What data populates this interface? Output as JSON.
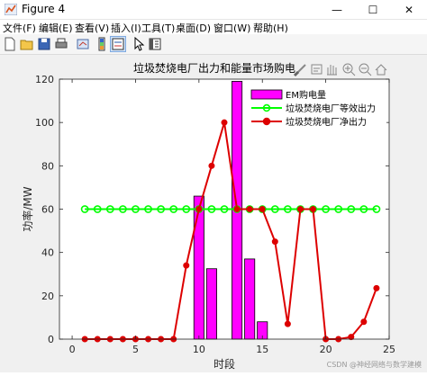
{
  "window": {
    "title": "Figure 4",
    "minimize_glyph": "—",
    "maximize_glyph": "☐",
    "close_glyph": "✕"
  },
  "menu": [
    "文件(F)",
    "编辑(E)",
    "查看(V)",
    "插入(I)",
    "工具(T)",
    "桌面(D)",
    "窗口(W)",
    "帮助(H)"
  ],
  "toolbar_icons": [
    "new-figure-icon",
    "open-file-icon",
    "save-icon",
    "print-icon",
    "link-axes-icon",
    "insert-colorbar-icon",
    "insert-legend-icon",
    "edit-plot-arrow-icon",
    "property-inspector-icon"
  ],
  "axes_toolbar_icons": [
    "brush-icon",
    "data-tips-icon",
    "pan-hand-icon",
    "zoom-in-icon",
    "zoom-out-icon",
    "home-icon"
  ],
  "watermark": "CSDN @神经网络与数学建模",
  "chart_data": {
    "type": "bar+line",
    "title": "垃圾焚烧电厂出力和能量市场购电",
    "xlabel": "时段",
    "ylabel": "功率/MW",
    "xlim": [
      -1,
      25
    ],
    "ylim": [
      0,
      120
    ],
    "xticks": [
      0,
      5,
      10,
      15,
      20,
      25
    ],
    "yticks": [
      0,
      20,
      40,
      60,
      80,
      100,
      120
    ],
    "grid": false,
    "legend_position": "top-right",
    "categories": [
      1,
      2,
      3,
      4,
      5,
      6,
      7,
      8,
      9,
      10,
      11,
      12,
      13,
      14,
      15,
      16,
      17,
      18,
      19,
      20,
      21,
      22,
      23,
      24
    ],
    "series": [
      {
        "name": "EM购电量",
        "type": "bar",
        "color": "#ff00ff",
        "edge": "#000000",
        "values": [
          0,
          0,
          0,
          0,
          0,
          0,
          0,
          0,
          0,
          66,
          32.5,
          0,
          119,
          37,
          8,
          0,
          0,
          0,
          0,
          0,
          0,
          0,
          0,
          0
        ]
      },
      {
        "name": "垃圾焚烧电厂等效出力",
        "type": "line",
        "marker": "open-circle",
        "color": "#00ff00",
        "values": [
          60,
          60,
          60,
          60,
          60,
          60,
          60,
          60,
          60,
          60,
          60,
          60,
          60,
          60,
          60,
          60,
          60,
          60,
          60,
          60,
          60,
          60,
          60,
          60
        ]
      },
      {
        "name": "垃圾焚烧电厂净出力",
        "type": "line",
        "marker": "filled-circle",
        "color": "#dd0000",
        "values": [
          0,
          0,
          0,
          0,
          0,
          0,
          0,
          0,
          34,
          60,
          80,
          100,
          60,
          60,
          60,
          45,
          7,
          60,
          60,
          0,
          0,
          1,
          8,
          23.5
        ]
      }
    ]
  }
}
